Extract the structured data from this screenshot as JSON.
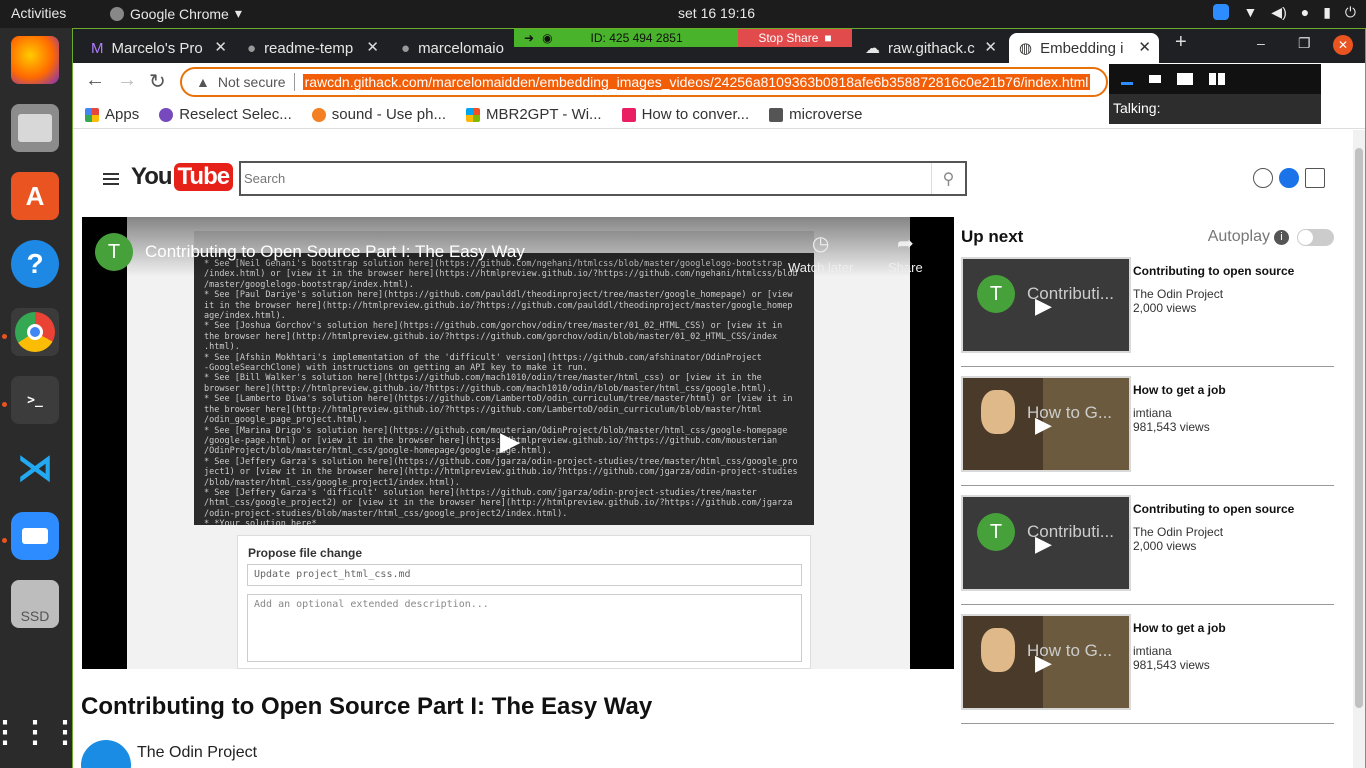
{
  "topbar": {
    "activities": "Activities",
    "app": "Google Chrome",
    "clock": "set 16  19:16"
  },
  "dock": {
    "items": [
      "firefox-icon",
      "files-icon",
      "software-icon",
      "help-icon",
      "chrome-icon",
      "terminal-icon",
      "vscode-icon",
      "zoom-icon",
      "ssd-icon",
      "apps-grid-icon"
    ],
    "ssd_label": "SSD"
  },
  "tabs": [
    {
      "label": "Marcelo's Pro"
    },
    {
      "label": "readme-temp"
    },
    {
      "label": "marcelomaio"
    },
    {
      "label": "raw.githack.c"
    },
    {
      "label": "Embedding i"
    }
  ],
  "share": {
    "id": "ID: 425 494 2851",
    "stop": "Stop Share"
  },
  "omnibox": {
    "security": "Not secure",
    "url": "rawcdn.githack.com/marcelomaidden/embedding_images_videos/24256a8109363b0818afe6b358872816c0e21b76/index.html"
  },
  "bookmarks": [
    {
      "label": "Apps",
      "color": "#e8453c"
    },
    {
      "label": "Reselect Selec...",
      "color": "#764abc"
    },
    {
      "label": "sound - Use ph...",
      "color": "#f48024"
    },
    {
      "label": "MBR2GPT - Wi...",
      "color": "#00a4ef"
    },
    {
      "label": "How to conver...",
      "color": "#e91e63"
    },
    {
      "label": "microverse",
      "color": "#555555"
    }
  ],
  "zoomctl": {
    "talking": "Talking:"
  },
  "youtube": {
    "logo_you": "You",
    "logo_tube": "Tube",
    "search_placeholder": "Search"
  },
  "player": {
    "avatar_letter": "T",
    "title": "Contributing to Open Source Part I: The Easy Way",
    "watch_later": "Watch later",
    "share": "Share",
    "code_lines": [
      "  * See [Neil Gehani's bootstrap solution here](https://github.com/ngehani/htmlcss/blob/master/googlelogo-bootstrap",
      "/index.html) or [view it in the browser here](https://htmlpreview.github.io/?https://github.com/ngehani/htmlcss/blob",
      "/master/googlelogo-bootstrap/index.html).",
      "* See [Paul Dariye's solution here](https://github.com/paulddl/theodinproject/tree/master/google_homepage) or [view",
      "it in the browser here](http://htmlpreview.github.io/?https://github.com/paulddl/theodinproject/master/google_homep",
      "age/index.html).",
      "* See [Joshua Gorchov's solution here](https://github.com/gorchov/odin/tree/master/01_02_HTML_CSS) or [view it in",
      "the browser here](http://htmlpreview.github.io/?https://github.com/gorchov/odin/blob/master/01_02_HTML_CSS/index",
      ".html).",
      "* See [Afshin Mokhtari's implementation of the 'difficult' version](https://github.com/afshinator/OdinProject",
      "-GoogleSearchClone) with instructions on getting an API key to make it run.",
      "* See [Bill Walker's solution here](https://github.com/mach1010/odin/tree/master/html_css) or [view it in the",
      "browser here](http://htmlpreview.github.io/?https://github.com/mach1010/odin/blob/master/html_css/google.html).",
      "* See [Lamberto Diwa's solution here](https://github.com/LambertoD/odin_curriculum/tree/master/html) or [view it in",
      "the browser here](http://htmlpreview.github.io/?https://github.com/LambertoD/odin_curriculum/blob/master/html",
      "/odin_google_page_project.html).",
      "* See [Marina Drigo's solution here](https://github.com/mouterian/OdinProject/blob/master/html_css/google-homepage",
      "/google-page.html) or [view it in the browser here](https://htmlpreview.github.io/?https://github.com/mousterian",
      "/OdinProject/blob/master/html_css/google-homepage/google-page.html).",
      "* See [Jeffery Garza's solution here](https://github.com/jgarza/odin-project-studies/tree/master/html_css/google_pro",
      "ject1) or [view it in the browser here](http://htmlpreview.github.io/?https://github.com/jgarza/odin-project-studies",
      "/blob/master/html_css/google_project1/index.html).",
      "* See [Jeffery Garza's 'difficult' solution here](https://github.com/jgarza/odin-project-studies/tree/master",
      "/html_css/google_project2) or [view it in the browser here](http://htmlpreview.github.io/?https://github.com/jgarza",
      "/odin-project-studies/blob/master/html_css/google_project2/index.html).",
      "* *Your solution here*"
    ],
    "propose_title": "Propose file change",
    "propose_field": "Update project_html_css.md",
    "propose_desc": "Add an optional extended description..."
  },
  "video": {
    "title": "Contributing to Open Source Part I: The Easy Way",
    "channel": "The Odin Project"
  },
  "upnext": {
    "label": "Up next",
    "autoplay": "Autoplay",
    "cards": [
      {
        "title": "Contributing to open source",
        "channel": "The Odin Project",
        "views": "2,000 views",
        "thumb_text": "Contributi...",
        "kind": "odin"
      },
      {
        "title": "How to get a job",
        "channel": "imtiana",
        "views": "981,543 views",
        "thumb_text": "How to G...",
        "kind": "job"
      },
      {
        "title": "Contributing to open source",
        "channel": "The Odin Project",
        "views": "2,000 views",
        "thumb_text": "Contributi...",
        "kind": "odin"
      },
      {
        "title": "How to get a job",
        "channel": "imtiana",
        "views": "981,543 views",
        "thumb_text": "How to G...",
        "kind": "job"
      }
    ]
  },
  "colors": {
    "accent_orange": "#f25e08",
    "yt_red": "#e62117",
    "share_green": "#49b32b",
    "share_red": "#e24b4b"
  }
}
